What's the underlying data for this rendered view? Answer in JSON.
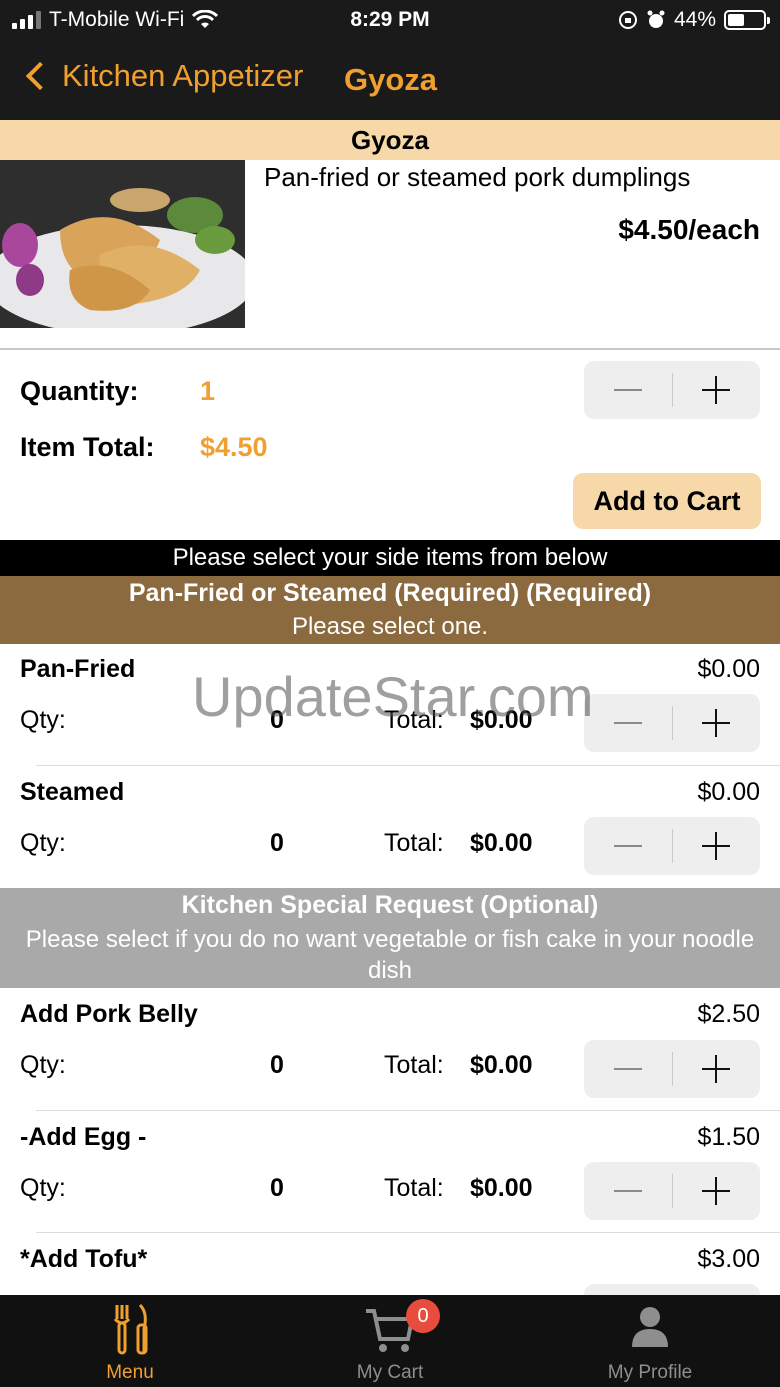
{
  "status_bar": {
    "carrier": "T-Mobile Wi-Fi",
    "time": "8:29 PM",
    "battery": "44%"
  },
  "nav": {
    "back_label": "Kitchen Appetizer",
    "title": "Gyoza"
  },
  "item": {
    "name": "Gyoza",
    "description": "Pan-fried or steamed pork dumplings",
    "unit_price": "$4.50/each",
    "image": "gyoza-dumplings-photo"
  },
  "order": {
    "quantity_label": "Quantity:",
    "quantity": "1",
    "total_label": "Item Total:",
    "total": "$4.50",
    "add_to_cart_label": "Add to Cart"
  },
  "side_items_banner": "Please select your side items from below",
  "groups": [
    {
      "title": "Pan-Fried or Steamed (Required) (Required)",
      "subtitle": "Please select one.",
      "options": [
        {
          "name": "Pan-Fried",
          "price": "$0.00",
          "qty_label": "Qty:",
          "qty": "0",
          "total_label": "Total:",
          "total": "$0.00"
        },
        {
          "name": "Steamed",
          "price": "$0.00",
          "qty_label": "Qty:",
          "qty": "0",
          "total_label": "Total:",
          "total": "$0.00"
        }
      ]
    },
    {
      "title": "Kitchen Special Request (Optional)",
      "subtitle": "Please select if you do no want vegetable or fish cake in your noodle dish",
      "options": [
        {
          "name": "Add Pork Belly",
          "price": "$2.50",
          "qty_label": "Qty:",
          "qty": "0",
          "total_label": "Total:",
          "total": "$0.00"
        },
        {
          "name": "-Add Egg -",
          "price": "$1.50",
          "qty_label": "Qty:",
          "qty": "0",
          "total_label": "Total:",
          "total": "$0.00"
        },
        {
          "name": "*Add Tofu*",
          "price": "$3.00"
        }
      ]
    }
  ],
  "watermark": "UpdateStar.com",
  "tab_bar": {
    "tabs": [
      {
        "label": "Menu",
        "icon": "utensils-icon",
        "active": true
      },
      {
        "label": "My Cart",
        "icon": "cart-icon",
        "badge": "0"
      },
      {
        "label": "My Profile",
        "icon": "profile-icon"
      }
    ]
  },
  "colors": {
    "accent": "#f0a030",
    "header_band": "#f7d8a8",
    "group_brown": "#8c6a3f",
    "group_gray": "#a9a9a9",
    "badge": "#e74c3c"
  }
}
